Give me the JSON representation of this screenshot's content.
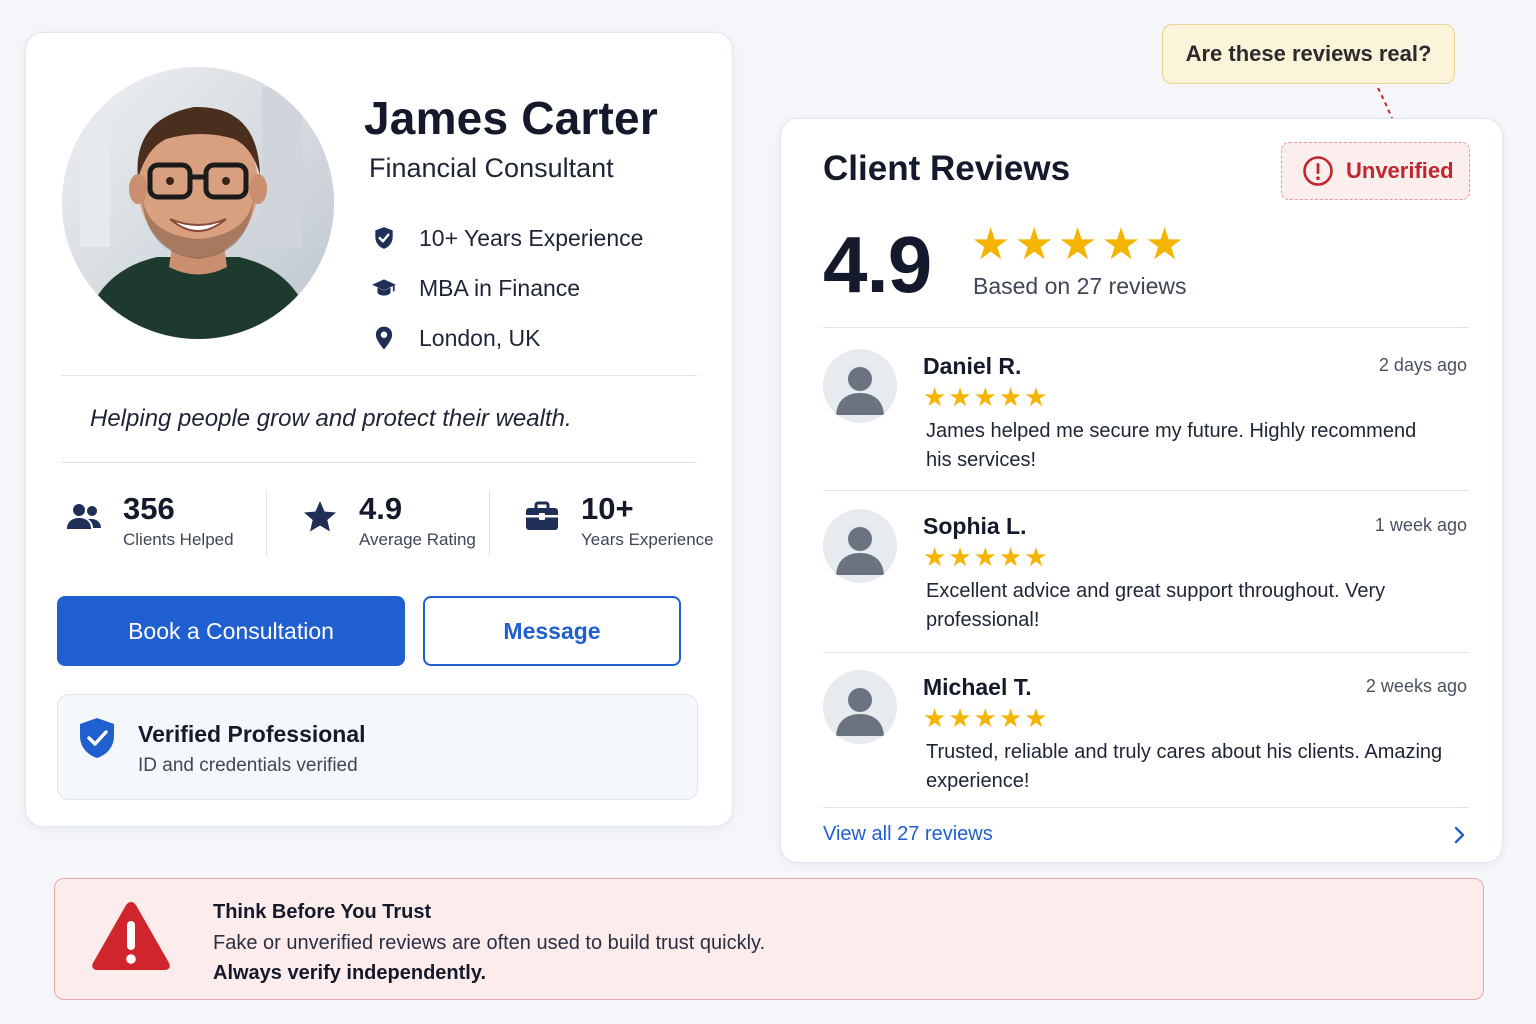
{
  "colors": {
    "primary": "#1f5fd0",
    "navy": "#1f2f57",
    "star": "#f5b400",
    "danger": "#c0262d",
    "callout_bg": "#fbf3da",
    "warning_bg": "#fdecec"
  },
  "profile": {
    "name": "James Carter",
    "title": "Financial Consultant",
    "facts": [
      {
        "icon": "shield-check-icon",
        "text": "10+ Years Experience"
      },
      {
        "icon": "graduation-cap-icon",
        "text": "MBA in Finance"
      },
      {
        "icon": "location-pin-icon",
        "text": "London, UK"
      }
    ],
    "tagline": "Helping people grow and protect their wealth.",
    "stats": [
      {
        "icon": "users-icon",
        "value": "356",
        "label": "Clients Helped"
      },
      {
        "icon": "star-icon",
        "value": "4.9",
        "label": "Average Rating"
      },
      {
        "icon": "briefcase-icon",
        "value": "10+",
        "label": "Years Experience"
      }
    ],
    "book_button": "Book a Consultation",
    "message_button": "Message",
    "verified": {
      "icon": "verified-shield-icon",
      "title": "Verified Professional",
      "subtitle": "ID and credentials verified"
    }
  },
  "callout": {
    "text": "Are these reviews real?"
  },
  "reviews": {
    "title": "Client Reviews",
    "badge": "Unverified",
    "rating": "4.9",
    "rating_stars": 5,
    "based_on": "Based on 27 reviews",
    "items": [
      {
        "name": "Daniel R.",
        "time": "2 days ago",
        "stars": 5,
        "text": "James helped me secure my future. Highly recommend his services!"
      },
      {
        "name": "Sophia L.",
        "time": "1 week ago",
        "stars": 5,
        "text": "Excellent advice and great support throughout. Very professional!"
      },
      {
        "name": "Michael T.",
        "time": "2 weeks ago",
        "stars": 5,
        "text": "Trusted, reliable and truly cares about his clients. Amazing experience!"
      }
    ],
    "view_all": "View all 27 reviews"
  },
  "warning": {
    "icon": "warning-triangle-icon",
    "title": "Think Before You Trust",
    "description": "Fake or unverified reviews are often used to build trust quickly.",
    "strong": "Always verify independently."
  }
}
